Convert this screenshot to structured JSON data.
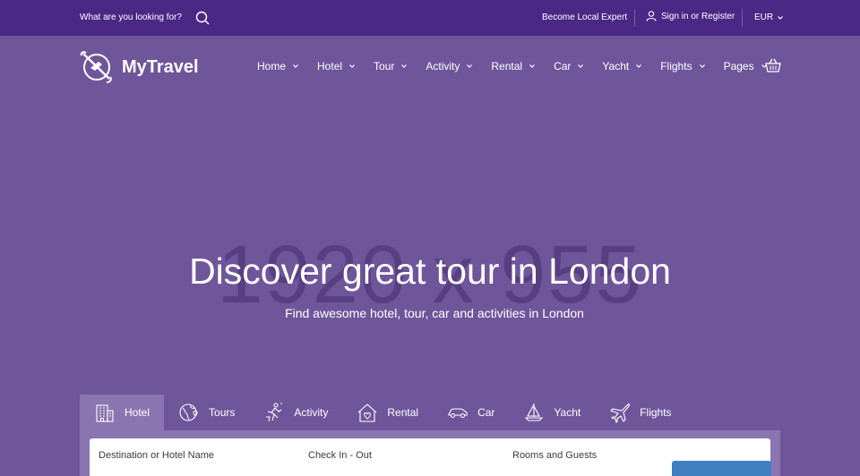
{
  "topbar": {
    "search_placeholder": "What are you looking for?",
    "become_expert": "Become Local Expert",
    "sign_in": "Sign in or Register",
    "currency": "EUR"
  },
  "brand": {
    "name": "MyTravel"
  },
  "nav": {
    "items": [
      "Home",
      "Hotel",
      "Tour",
      "Activity",
      "Rental",
      "Car",
      "Yacht",
      "Flights",
      "Pages"
    ]
  },
  "hero": {
    "watermark": "1920 x 955",
    "title": "Discover great tour in London",
    "subtitle": "Find awesome hotel, tour, car and activities in London"
  },
  "tabs": [
    "Hotel",
    "Tours",
    "Activity",
    "Rental",
    "Car",
    "Yacht",
    "Flights"
  ],
  "form": {
    "destination_label": "Destination or Hotel Name",
    "checkin_label": "Check In - Out",
    "guests_label": "Rooms and Guests"
  },
  "colors": {
    "topbar": "#4b2886",
    "hero": "#6f569a",
    "tab_active": "#8a75b1",
    "search_button": "#3f7fc2"
  }
}
